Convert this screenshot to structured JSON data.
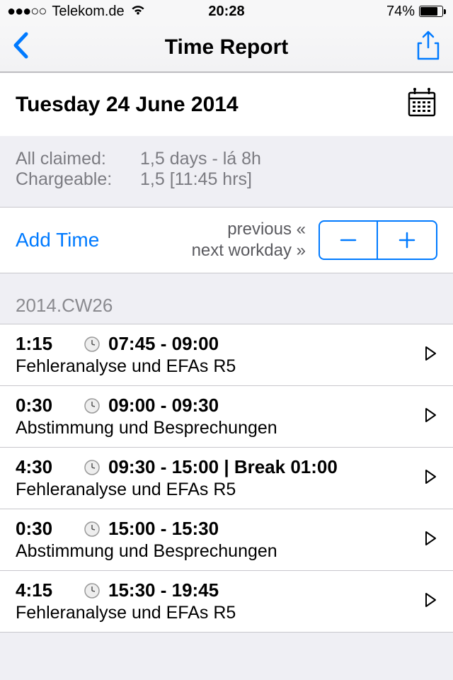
{
  "statusbar": {
    "signal_dots": "●●●○○",
    "carrier": "Telekom.de",
    "time": "20:28",
    "battery_pct": "74%"
  },
  "navbar": {
    "title": "Time Report"
  },
  "date_header": {
    "date": "Tuesday 24 June 2014"
  },
  "summary": {
    "claimed_label": "All claimed:",
    "claimed_value": "1,5 days - lá 8h",
    "chargeable_label": "Chargeable:",
    "chargeable_value": "1,5 [11:45 hrs]"
  },
  "controls": {
    "add_time": "Add Time",
    "prev_label": "previous «",
    "next_label": "next workday »"
  },
  "section": {
    "header": "2014.CW26"
  },
  "entries": [
    {
      "duration": "1:15",
      "range": "07:45 - 09:00",
      "desc": "Fehleranalyse und EFAs R5"
    },
    {
      "duration": "0:30",
      "range": "09:00 - 09:30",
      "desc": "Abstimmung und Besprechungen"
    },
    {
      "duration": "4:30",
      "range": "09:30 - 15:00 | Break 01:00",
      "desc": "Fehleranalyse und EFAs R5"
    },
    {
      "duration": "0:30",
      "range": "15:00 - 15:30",
      "desc": "Abstimmung und Besprechungen"
    },
    {
      "duration": "4:15",
      "range": "15:30 - 19:45",
      "desc": "Fehleranalyse und EFAs R5"
    }
  ]
}
